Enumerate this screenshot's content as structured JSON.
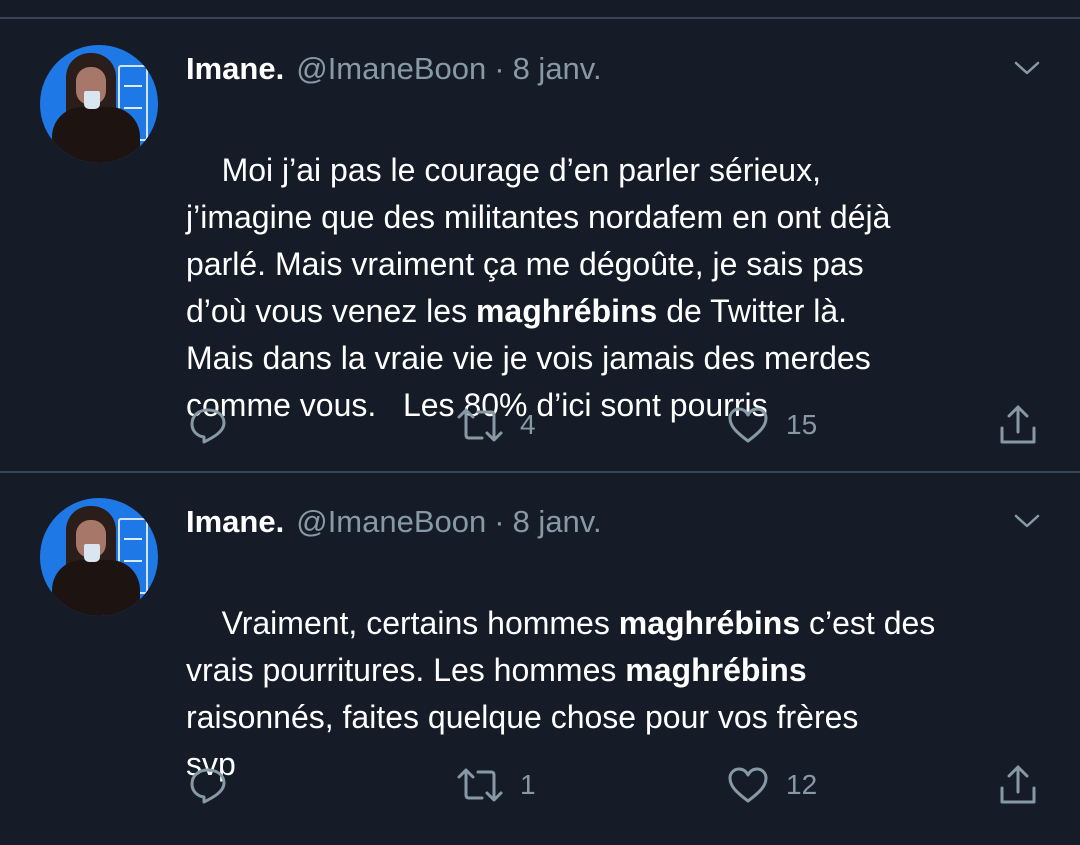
{
  "tweets": [
    {
      "name": "Imane.",
      "handle": "@ImaneBoon",
      "separator": "·",
      "date": "8 janv.",
      "text_parts": [
        {
          "text": "Moi j’ai pas le courage d’en parler sérieux,\nj’imagine que des militantes nordafem en ont déjà\nparlé. Mais vraiment ça me dégoûte, je sais pas\nd’où vous venez les ",
          "bold": false
        },
        {
          "text": "maghrébins",
          "bold": true
        },
        {
          "text": " de Twitter là.\nMais dans la vraie vie je vois jamais des merdes\ncomme vous.   Les 80% d’ici sont pourris",
          "bold": false
        }
      ],
      "retweets": "4",
      "likes": "15"
    },
    {
      "name": "Imane.",
      "handle": "@ImaneBoon",
      "separator": "·",
      "date": "8 janv.",
      "text_parts": [
        {
          "text": "Vraiment, certains hommes ",
          "bold": false
        },
        {
          "text": "maghrébins",
          "bold": true
        },
        {
          "text": " c’est des\nvrais pourritures. Les hommes ",
          "bold": false
        },
        {
          "text": "maghrébins",
          "bold": true
        },
        {
          "text": "\nraisonnés, faites quelque chose pour vos frères\nsvp",
          "bold": false
        }
      ],
      "retweets": "1",
      "likes": "12"
    }
  ],
  "icons": {
    "reply": "reply-icon",
    "retweet": "retweet-icon",
    "like": "heart-icon",
    "share": "share-icon",
    "menu": "chevron-down-icon"
  },
  "colors": {
    "background": "#151c28",
    "secondary_text": "#8899a6",
    "divider": "#394454",
    "avatar_bg": "#1e79e6"
  }
}
